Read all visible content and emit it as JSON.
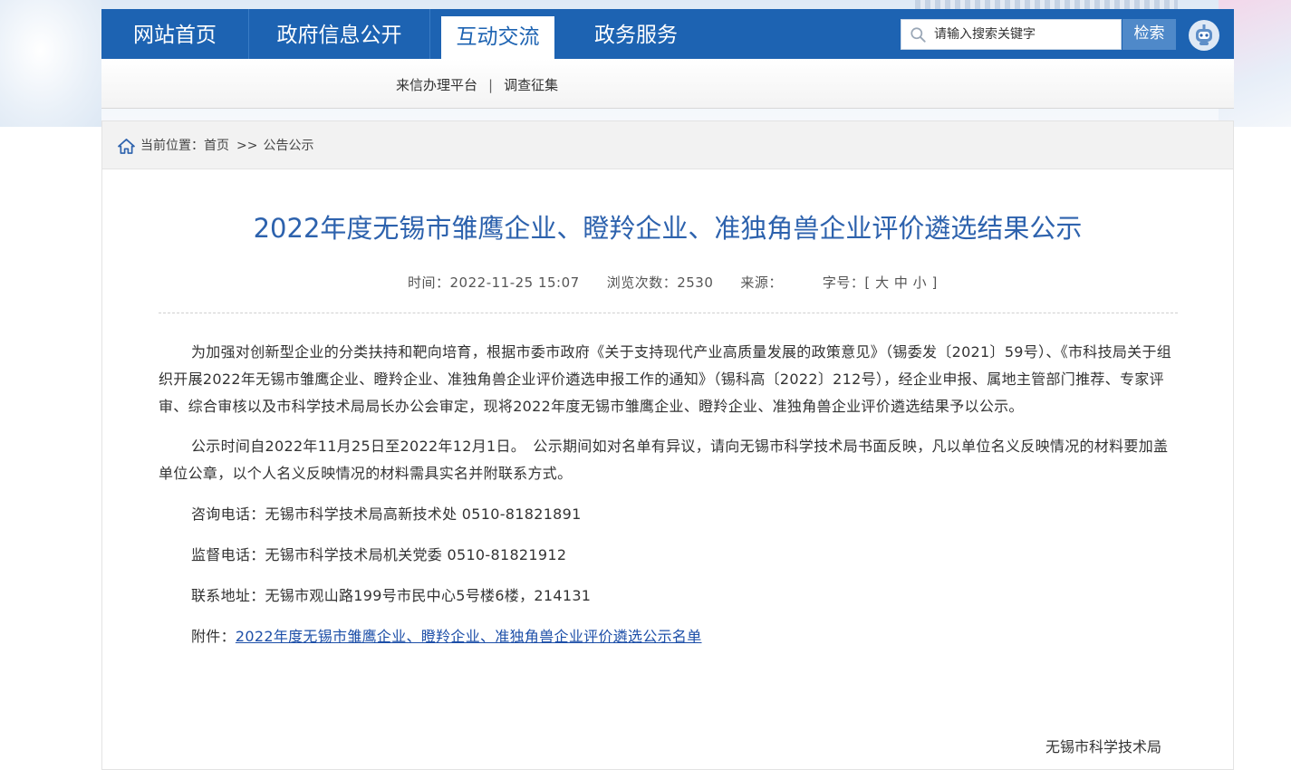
{
  "nav": {
    "items": [
      "网站首页",
      "政府信息公开",
      "互动交流",
      "政务服务"
    ],
    "active_index": 2,
    "search_placeholder": "请输入搜索关键字",
    "search_button": "检索",
    "colors": {
      "nav_bg": "#1d63b2",
      "title": "#2d62ad"
    }
  },
  "subnav": {
    "links": [
      "来信办理平台",
      "调查征集"
    ],
    "separator": "|"
  },
  "breadcrumb": {
    "label": "当前位置：",
    "home": "首页",
    "arrow": ">>",
    "current": "公告公示"
  },
  "article": {
    "title": "2022年度无锡市雏鹰企业、瞪羚企业、准独角兽企业评价遴选结果公示",
    "meta": {
      "time_label": "时间：",
      "time": "2022-11-25 15:07",
      "views_label": "浏览次数：",
      "views": "2530",
      "source_label": "来源：",
      "font_label": "字号：",
      "font_open": "[",
      "font_large": "大",
      "font_medium": "中",
      "font_small": "小",
      "font_close": "]"
    },
    "paragraph1": "为加强对创新型企业的分类扶持和靶向培育，根据市委市政府《关于支持现代产业高质量发展的政策意见》（锡委发〔2021〕59号）、《市科技局关于组织开展2022年无锡市雏鹰企业、瞪羚企业、准独角兽企业评价遴选申报工作的通知》（锡科高〔2022〕212号），经企业申报、属地主管部门推荐、专家评审、综合审核以及市科学技术局局长办公会审定，现将2022年度无锡市雏鹰企业、瞪羚企业、准独角兽企业评价遴选结果予以公示。",
    "paragraph2": "公示时间自2022年11月25日至2022年12月1日。　公示期间如对名单有异议，请向无锡市科学技术局书面反映，凡以单位名义反映情况的材料要加盖单位公章，以个人名义反映情况的材料需具实名并附联系方式。",
    "consult": "咨询电话：无锡市科学技术局高新技术处 0510-81821891",
    "supervise": "监督电话：无锡市科学技术局机关党委 0510-81821912",
    "address": "联系地址：无锡市观山路199号市民中心5号楼6楼，214131",
    "attachment_label": "附件：",
    "attachment_link": "2022年度无锡市雏鹰企业、瞪羚企业、准独角兽企业评价遴选公示名单",
    "signature": "无锡市科学技术局"
  }
}
